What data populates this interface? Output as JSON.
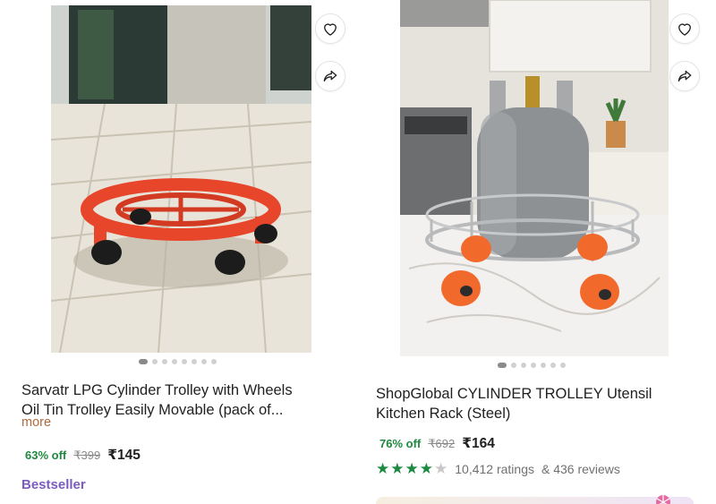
{
  "products": [
    {
      "title_line1": "Sarvatr LPG Cylinder Trolley with Wheels",
      "title_line2": "Oil Tin Trolley Easily Movable (pack of...",
      "more_label": "more",
      "discount": "63% off",
      "mrp": "₹399",
      "price": "₹145",
      "badge": "Bestseller",
      "image_icon": "red-cylinder-trolley-image",
      "wishlist_icon": "heart-icon",
      "share_icon": "share-icon",
      "carousel_count": 8,
      "carousel_active": 0
    },
    {
      "title_line1": "ShopGlobal CYLINDER TROLLEY Utensil",
      "title_line2": "Kitchen Rack (Steel)",
      "discount": "76% off",
      "mrp": "₹692",
      "price": "₹164",
      "rating_stars": 4,
      "ratings_text": "10,412 ratings",
      "reviews_text": "& 436 reviews",
      "image_icon": "steel-cylinder-trolley-image",
      "wishlist_icon": "heart-icon",
      "share_icon": "share-icon",
      "carousel_count": 7,
      "carousel_active": 0
    }
  ],
  "colors": {
    "discount": "#1f8a3f",
    "more_link": "#b0693a",
    "badge": "#7a5cc0",
    "star": "#1a8a3f"
  }
}
